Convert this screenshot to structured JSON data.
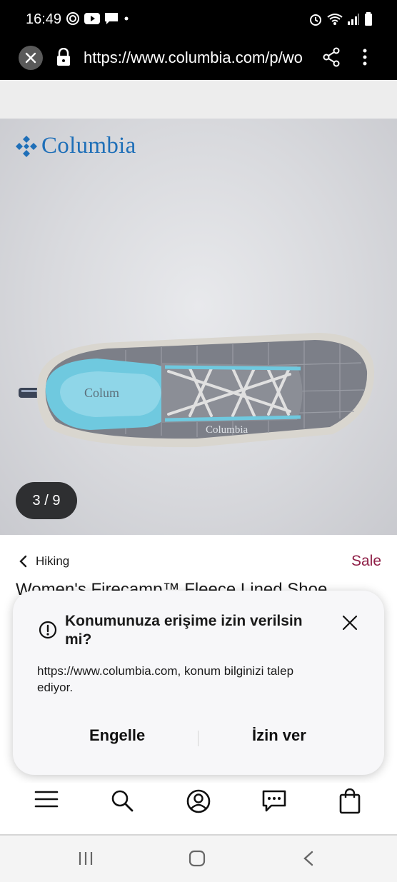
{
  "status_bar": {
    "time": "16:49",
    "left_icons": [
      "signal-app-icon",
      "youtube-icon",
      "message-icon",
      "dot-icon"
    ],
    "right_icons": [
      "alarm-icon",
      "wifi-icon",
      "cell-signal-icon",
      "battery-icon"
    ]
  },
  "browser": {
    "url": "https://www.columbia.com/p/wo",
    "icons": [
      "close-icon",
      "lock-icon",
      "share-icon",
      "more-vertical-icon"
    ]
  },
  "product": {
    "brand": "Columbia",
    "image_counter": "3 / 9",
    "breadcrumb": "Hiking",
    "sale_label": "Sale",
    "title": "Women's Firecamp™ Fleece Lined Shoe"
  },
  "dialog": {
    "title": "Konumunuza erişime izin verilsin mi?",
    "body": "https://www.columbia.com, konum bilginizi talep ediyor.",
    "block_label": "Engelle",
    "allow_label": "İzin ver"
  },
  "bottom_nav": {
    "items": [
      "menu-icon",
      "search-icon",
      "account-icon",
      "chat-icon",
      "bag-icon"
    ]
  },
  "system_nav": {
    "items": [
      "recent-apps-icon",
      "home-icon",
      "back-icon"
    ]
  },
  "colors": {
    "brand_blue": "#1e6fb8",
    "sale_red": "#8e1d45",
    "shoe_teal": "#6fc9df"
  }
}
